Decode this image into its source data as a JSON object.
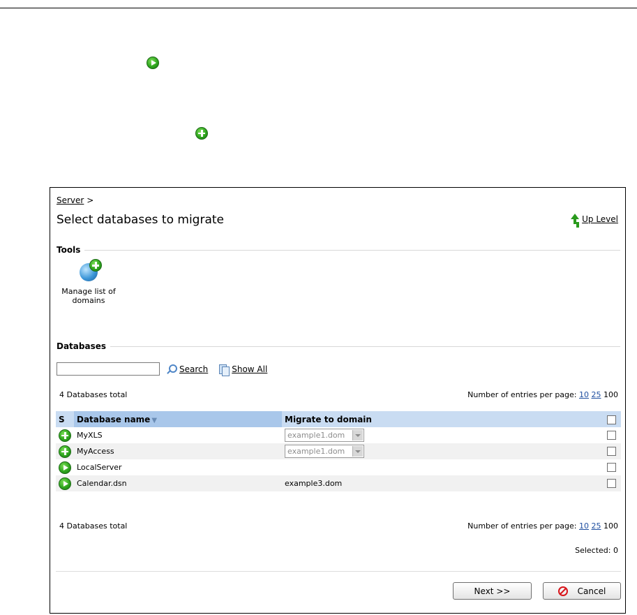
{
  "breadcrumb": "Server",
  "breadcrumb_sep": ">",
  "page_title": "Select databases to migrate",
  "up_level": "Up Level",
  "tools_header": "Tools",
  "tool_label": "Manage list of domains",
  "databases_header": "Databases",
  "search": {
    "value": "",
    "button": "Search",
    "show_all": "Show All"
  },
  "total_label": "4 Databases total",
  "per_page": {
    "label": "Number of entries per page:",
    "opt1": "10",
    "opt2": "25",
    "opt3": "100"
  },
  "columns": {
    "status": "S",
    "name": "Database name",
    "domain": "Migrate to domain"
  },
  "rows": [
    {
      "icon": "plus-icon",
      "name": "MyXLS",
      "domain": "example1.dom",
      "domain_is_select": true
    },
    {
      "icon": "plus-icon",
      "name": "MyAccess",
      "domain": "example1.dom",
      "domain_is_select": true
    },
    {
      "icon": "play-icon",
      "name": "LocalServer",
      "domain": "",
      "domain_is_select": false
    },
    {
      "icon": "play-icon",
      "name": "Calendar.dsn",
      "domain": "example3.dom",
      "domain_is_select": false
    }
  ],
  "selected_label": "Selected: 0",
  "buttons": {
    "next": "Next >>",
    "cancel": "Cancel"
  }
}
